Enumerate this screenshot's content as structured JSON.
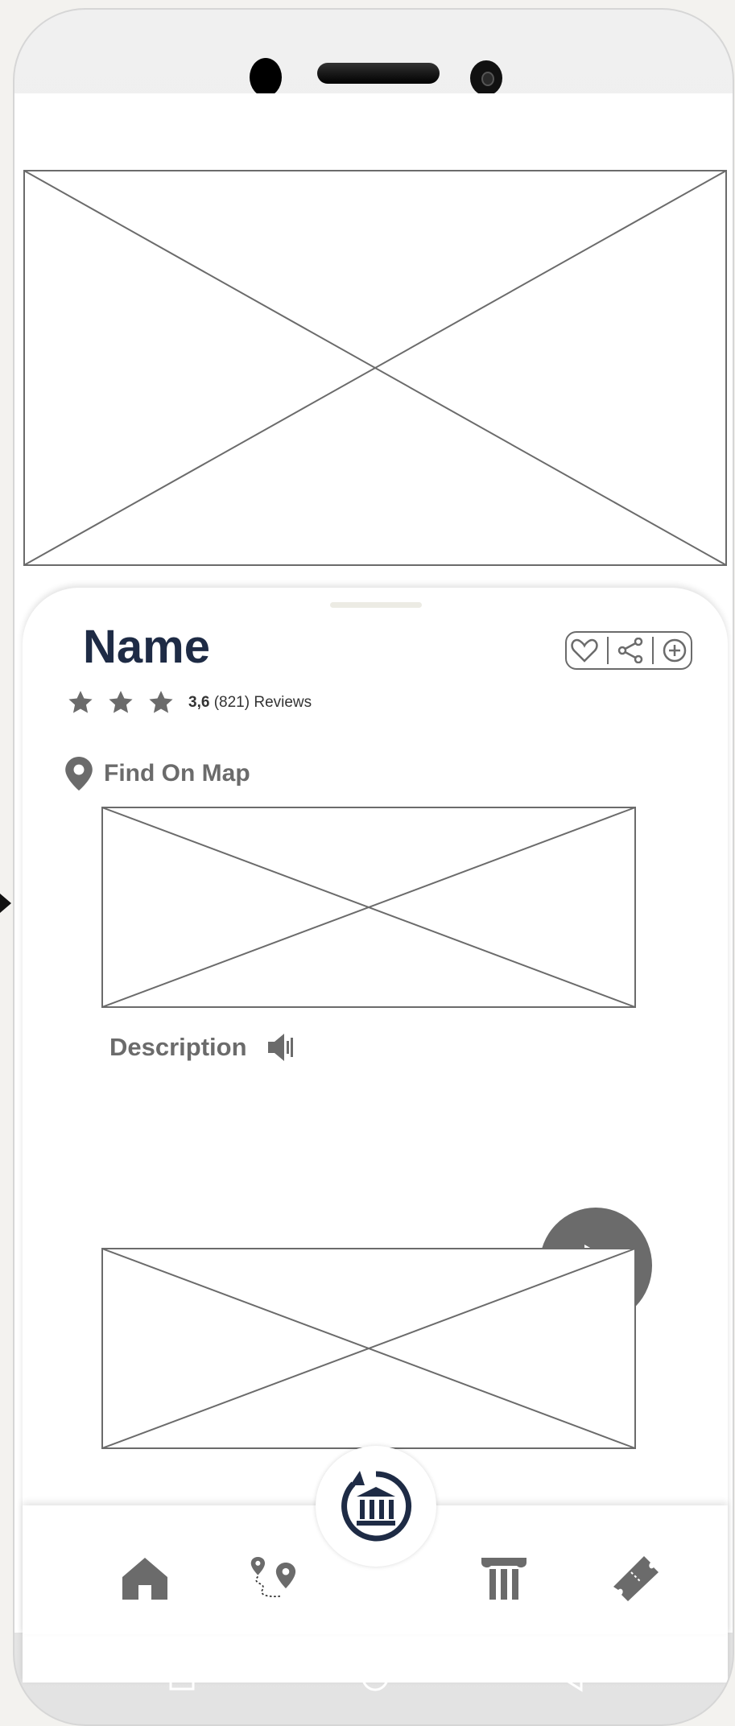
{
  "place": {
    "name": "Name",
    "rating": "3,6",
    "review_count": "(821)",
    "reviews_label": "Reviews",
    "stars": 3
  },
  "sections": {
    "find_on_map": "Find On Map",
    "description": "Description"
  },
  "actions": [
    "heart-icon",
    "share-icon",
    "add-icon"
  ],
  "nav": {
    "items": [
      "home-icon",
      "route-icon",
      "museum-icon",
      "column-icon",
      "ticket-icon"
    ]
  },
  "system_nav": [
    "recent-apps-icon",
    "home-circle-icon",
    "back-triangle-icon"
  ],
  "colors": {
    "title": "#1e2b45",
    "icon_gray": "#6b6b6b",
    "play_bg": "#6b6b6b"
  }
}
